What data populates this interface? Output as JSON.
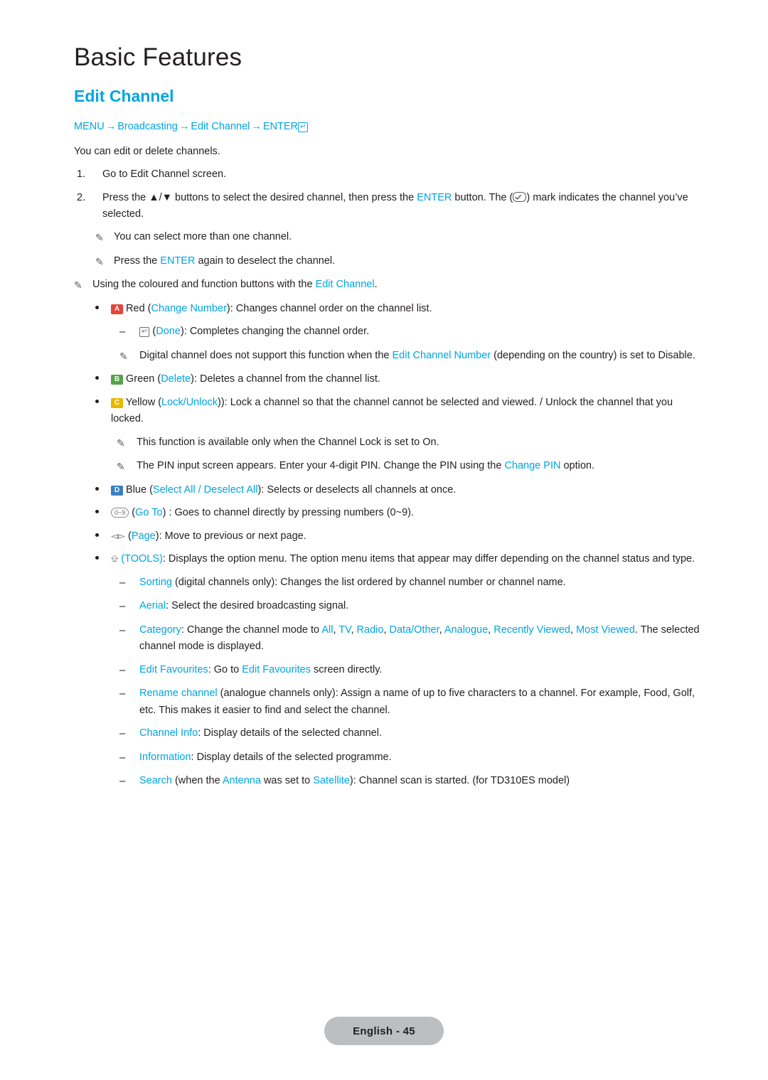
{
  "chapter_title": "Basic Features",
  "section_title": "Edit Channel",
  "menu_path": {
    "menu": "MENU",
    "arrow": "→",
    "broadcasting": "Broadcasting",
    "edit_channel": "Edit Channel",
    "enter": "ENTER"
  },
  "intro": "You can edit or delete channels.",
  "steps": [
    {
      "number": "1.",
      "text": "Go to Edit Channel screen."
    },
    {
      "number": "2.",
      "pre": "Press the ▲/▼ buttons to select the desired channel, then press the ",
      "enter": "ENTER",
      "mid": " button. The (",
      "post": ") mark indicates the channel you’ve selected."
    }
  ],
  "notes_top": [
    "You can select more than one channel.",
    "Press the ENTER again to deselect the channel."
  ],
  "note_enter_label": "ENTER",
  "note_using": {
    "pre": "Using the coloured and function buttons with the ",
    "link": "Edit Channel",
    "post": "."
  },
  "bullets": [
    {
      "key": "A",
      "key_class": "key-a",
      "pre": "Red (",
      "link": "Change Number",
      "post": "): Changes channel order on the channel list."
    },
    {
      "key": "B",
      "key_class": "key-b",
      "pre": "Green (",
      "link": "Delete",
      "post": "): Deletes a channel from the channel list."
    },
    {
      "key": "C",
      "key_class": "key-c",
      "pre": "Yellow (",
      "link": "Lock/Unlock",
      "post": ")): Lock a channel so that the channel cannot be selected and viewed. / Unlock the channel that you locked."
    },
    {
      "key": "D",
      "key_class": "key-d",
      "pre": "Blue (",
      "link": "Select All",
      "sep": " / ",
      "link2": "Deselect All",
      "post": "): Selects or deselects all channels at once."
    }
  ],
  "sub_done": {
    "pre": "(",
    "link": "Done",
    "post": "): Completes changing the channel order."
  },
  "note_digital": {
    "pre": "Digital channel does not support this function when the ",
    "link": "Edit Channel Number",
    "post": " (depending on the country) is set to Disable."
  },
  "note_channel_lock": "This function is available only when the Channel Lock is set to On.",
  "note_pin": {
    "pre": "The PIN input screen appears. Enter your 4-digit PIN. Change the PIN using the ",
    "link": "Change PIN",
    "post": " option."
  },
  "goto_bullet": {
    "keys": "0~9",
    "link": "Go To",
    "post": " : Goes to channel directly by pressing numbers (0~9)."
  },
  "page_bullet": {
    "link": "Page",
    "post": "): Move to previous or next page.",
    "open": "("
  },
  "tools_bullet": {
    "label": "(TOOLS)",
    "post": ": Displays the option menu. The option menu items that appear may differ depending on the channel status and type."
  },
  "tools_items": [
    {
      "link": "Sorting",
      "post": " (digital channels only): Changes the list ordered by channel number or channel name."
    },
    {
      "link": "Aerial",
      "post": ": Select the desired broadcasting signal."
    },
    {
      "link": "Category",
      "post": ": Change the channel mode to ",
      "options": [
        "All",
        "TV",
        "Radio",
        "Data/Other",
        "Analogue",
        "Recently Viewed",
        "Most Viewed"
      ],
      "tail": ". The selected channel mode is displayed."
    },
    {
      "link": "Edit Favourites",
      "post": ": Go to ",
      "link2": "Edit Favourites",
      "tail": " screen directly."
    },
    {
      "link": "Rename channel",
      "post": " (analogue channels only): Assign a name of up to five characters to a channel. For example, Food, Golf, etc. This makes it easier to find and select the channel."
    },
    {
      "link": "Channel Info",
      "post": ": Display details of the selected channel."
    },
    {
      "link": "Information",
      "post": ": Display details of the selected programme."
    },
    {
      "link": "Search",
      "pre2": " (when the ",
      "link2": "Antenna",
      "mid2": " was set to ",
      "link3": "Satellite",
      "tail": "): Channel scan is started. (for TD310ES model)"
    }
  ],
  "footer": "English - 45",
  "colors": {
    "accent": "#00a5e0",
    "text": "#231f20",
    "footer_bg": "#bcbec0"
  }
}
